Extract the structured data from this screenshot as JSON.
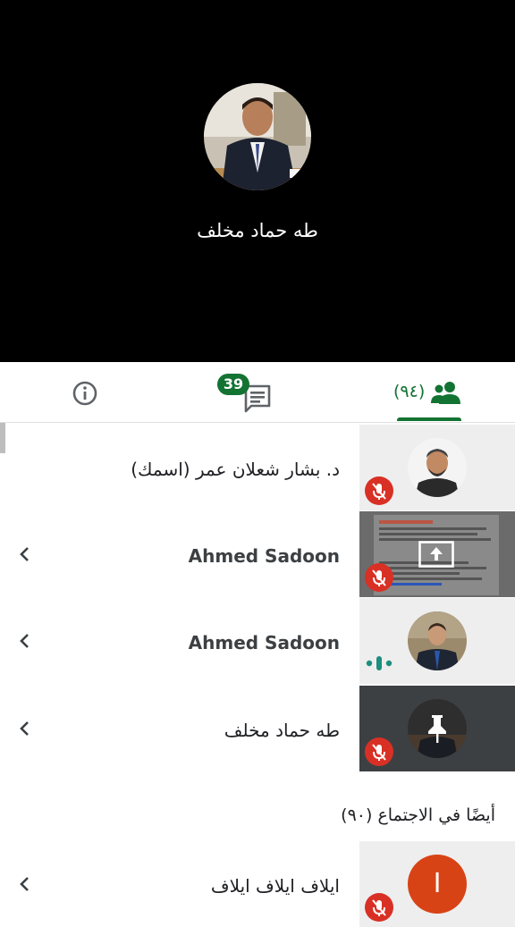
{
  "speaker": {
    "name": "طه حماد مخلف",
    "avatar_icon": "person-photo"
  },
  "tabs": {
    "info_icon": "info-icon",
    "chat_badge": "39",
    "people_count": "(٩٤)"
  },
  "participants": [
    {
      "name": "د. بشار شعلان عمر (اسمك)",
      "muted": true,
      "latin": false
    },
    {
      "name": "Ahmed Sadoon",
      "muted": true,
      "latin": true,
      "presenting": true
    },
    {
      "name": "Ahmed Sadoon",
      "muted": false,
      "latin": true,
      "speaking": true
    },
    {
      "name": "طه حماد مخلف",
      "muted": true,
      "latin": false,
      "pinned": true
    }
  ],
  "also_in_meeting": {
    "title": "أيضًا في الاجتماع (٩٠)",
    "participants": [
      {
        "name": "ايلاف ايلاف ايلاف",
        "initial": "I",
        "muted": true
      }
    ]
  },
  "colors": {
    "accent": "#137333",
    "muted_red": "#d93025",
    "avatar_orange": "#d84315"
  }
}
